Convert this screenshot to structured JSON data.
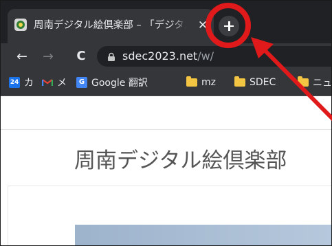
{
  "tab": {
    "title": "周南デジタル絵倶楽部 – 「デジタル絵",
    "close_glyph": "✕"
  },
  "toolbar": {
    "back_glyph": "←",
    "forward_glyph": "→",
    "reload_glyph": "C",
    "url_host": "sdec2023.net",
    "url_path": "/w/"
  },
  "bookmarks": [
    {
      "icon": "google-calendar-icon",
      "icon_text": "24",
      "label": "カ"
    },
    {
      "icon": "gmail-icon",
      "icon_text": "",
      "label": "メ"
    },
    {
      "icon": "google-translate-icon",
      "icon_text": "G",
      "label": "Google 翻訳"
    },
    {
      "icon": "folder-icon",
      "icon_text": "",
      "label": "mz"
    },
    {
      "icon": "folder-icon",
      "icon_text": "",
      "label": "SDEC"
    },
    {
      "icon": "folder-icon",
      "icon_text": "",
      "label": "ニュース"
    }
  ],
  "page": {
    "site_title": "周南デジタル絵倶楽部"
  },
  "colors": {
    "annotation": "#e0191b",
    "tabstrip": "#202124",
    "toolbar": "#35363a"
  }
}
